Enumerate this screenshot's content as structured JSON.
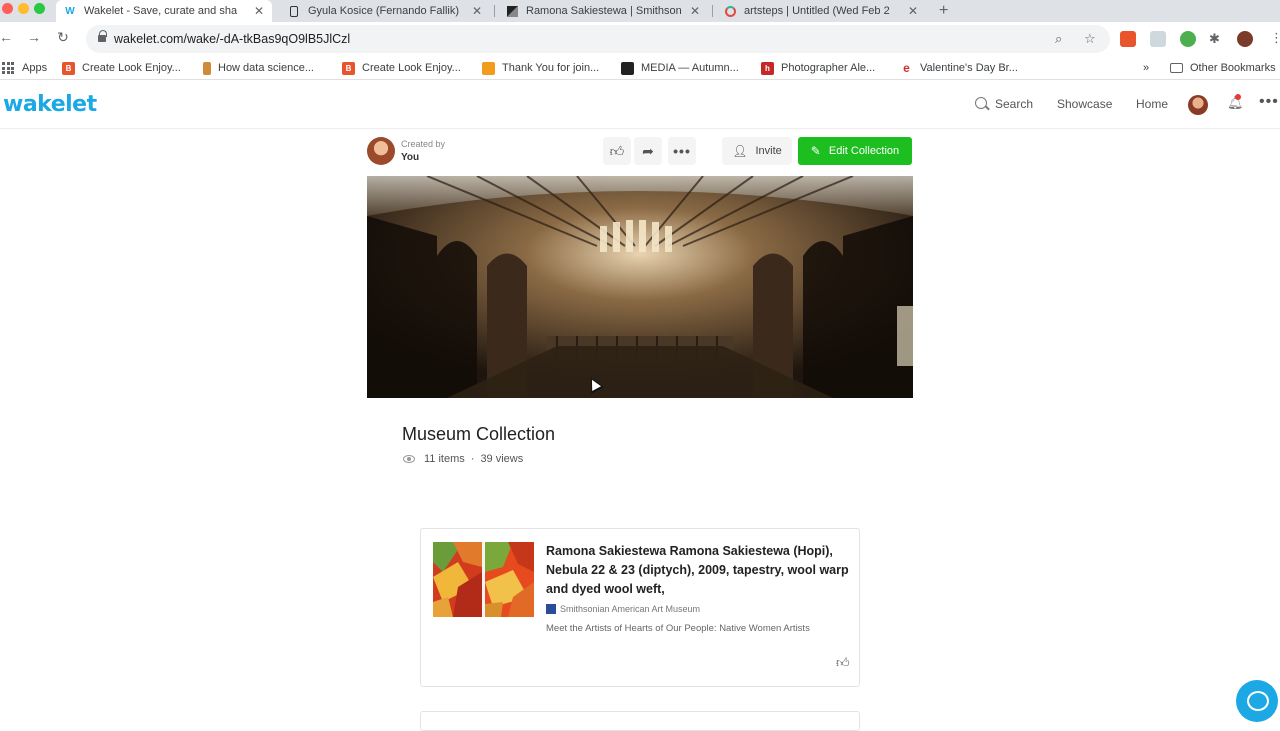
{
  "browser": {
    "tabs": [
      {
        "title": "Wakelet - Save, curate and sha",
        "favicon": "W",
        "active": true
      },
      {
        "title": "Gyula Kosice (Fernando Fallik)",
        "favicon": "",
        "active": false
      },
      {
        "title": "Ramona Sakiestewa | Smithson",
        "favicon": "",
        "active": false
      },
      {
        "title": "artsteps | Untitled (Wed Feb 2",
        "favicon": "",
        "active": false
      }
    ],
    "new_tab_icon": "plus-icon",
    "url": "wakelet.com/wake/-dA-tkBas9qO9lB5JlCzl",
    "bookmarks": [
      {
        "label": "Apps",
        "color": "#5f6368"
      },
      {
        "label": "Create Look Enjoy...",
        "color": "#e8542c"
      },
      {
        "label": "How data science...",
        "color": "#d08b3a"
      },
      {
        "label": "Create Look Enjoy...",
        "color": "#e8542c"
      },
      {
        "label": "Thank You for join...",
        "color": "#f29b1d"
      },
      {
        "label": "MEDIA — Autumn...",
        "color": "#222222"
      },
      {
        "label": "Photographer Ale...",
        "color": "#c62828"
      },
      {
        "label": "Valentine's Day Br...",
        "color": "#d32f2f"
      }
    ],
    "bookmarks_overflow": "»",
    "other_bookmarks": "Other Bookmarks"
  },
  "header": {
    "logo": "wakelet",
    "nav": {
      "search": "Search",
      "showcase": "Showcase",
      "home": "Home"
    }
  },
  "collection": {
    "created_by_label": "Created by",
    "creator": "You",
    "invite_label": "Invite",
    "edit_label": "Edit Collection",
    "title": "Museum Collection",
    "items_count": "11 items",
    "separator": "·",
    "views_count": "39 views"
  },
  "items": [
    {
      "title": "Ramona Sakiestewa Ramona Sakiestewa (Hopi), Nebula 22 & 23 (diptych), 2009, tapestry, wool warp and dyed wool weft,",
      "source": "Smithsonian American Art Museum",
      "description": "Meet the Artists of Hearts of Our People: Native Women Artists"
    }
  ],
  "colors": {
    "brand": "#1ba8e5",
    "edit_button": "#1dbe20"
  }
}
